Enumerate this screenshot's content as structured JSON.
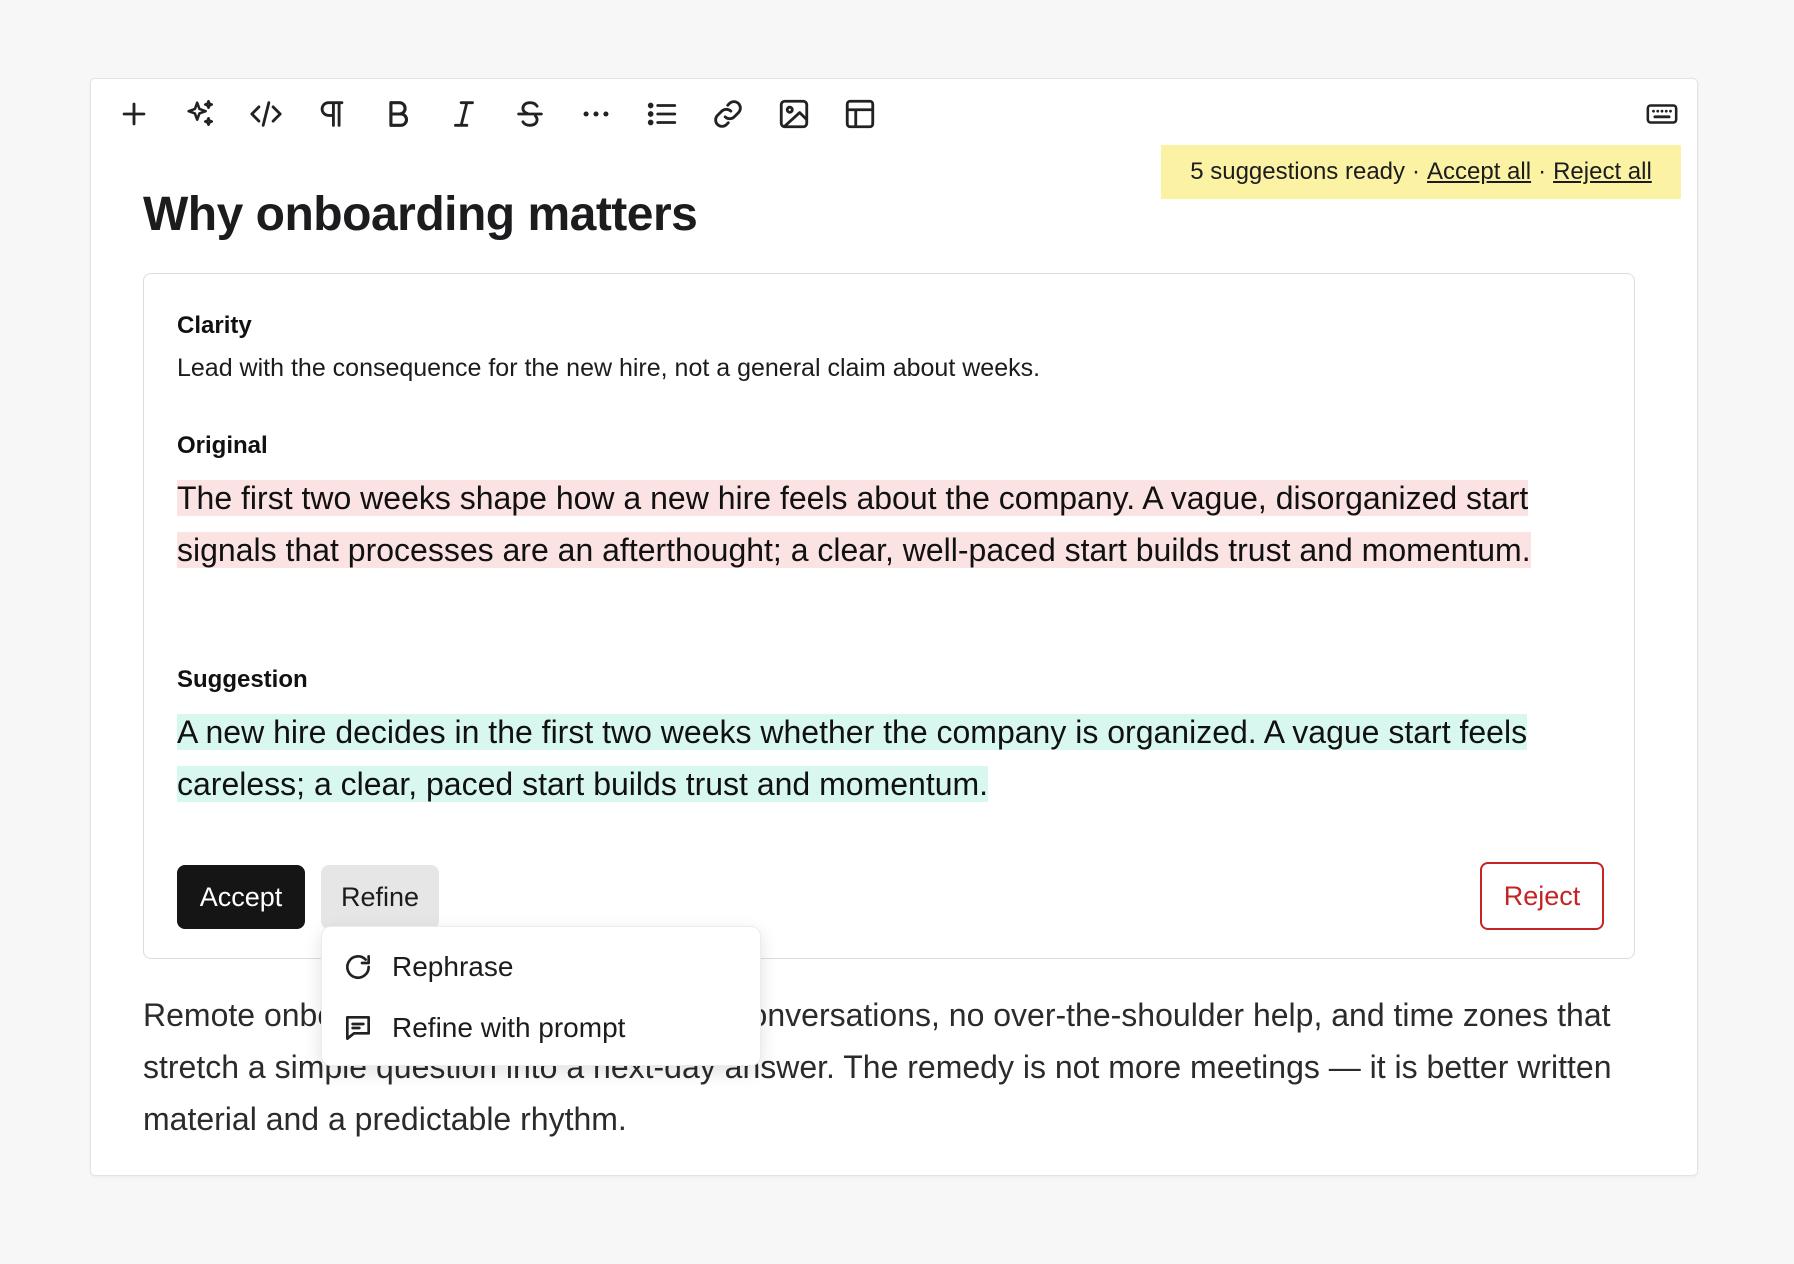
{
  "toolbar": {
    "icons": [
      "plus-icon",
      "sparkles-icon",
      "code-icon",
      "paragraph-icon",
      "bold-icon",
      "italic-icon",
      "strikethrough-icon",
      "more-icon",
      "bullet-list-icon",
      "link-icon",
      "image-icon",
      "table-icon",
      "keyboard-icon"
    ]
  },
  "banner": {
    "count_text": "5 suggestions ready",
    "separator": "·",
    "accept_all": "Accept all",
    "reject_all": "Reject all",
    "color": "#fbf2a4"
  },
  "document": {
    "title": "Why onboarding matters",
    "body": "Remote onboarding removes the hallway conversations, no over-the-shoulder help, and time zones that stretch a simple question into a next-day answer. The remedy is not more meetings — it is better written material and a predictable rhythm."
  },
  "suggestion": {
    "category": "Clarity",
    "reason": "Lead with the consequence for the new hire, not a general claim about weeks.",
    "original_label": "Original",
    "original_text": "The first two weeks shape how a new hire feels about the company. A vague, disorganized start signals that processes are an afterthought; a clear, well-paced start builds trust and momentum.",
    "suggestion_label": "Suggestion",
    "suggestion_text": "A new hire decides in the first two weeks whether the company is organized. A vague start feels careless; a clear, paced start builds trust and momentum.",
    "accept_label": "Accept",
    "refine_label": "Refine",
    "reject_label": "Reject",
    "colors": {
      "original_highlight": "#fbe3e4",
      "suggestion_highlight": "#d8f8ef",
      "reject": "#c42424"
    }
  },
  "refine_menu": {
    "items": [
      {
        "label": "Rephrase",
        "icon": "refresh-icon"
      },
      {
        "label": "Refine with prompt",
        "icon": "chat-icon"
      }
    ]
  }
}
